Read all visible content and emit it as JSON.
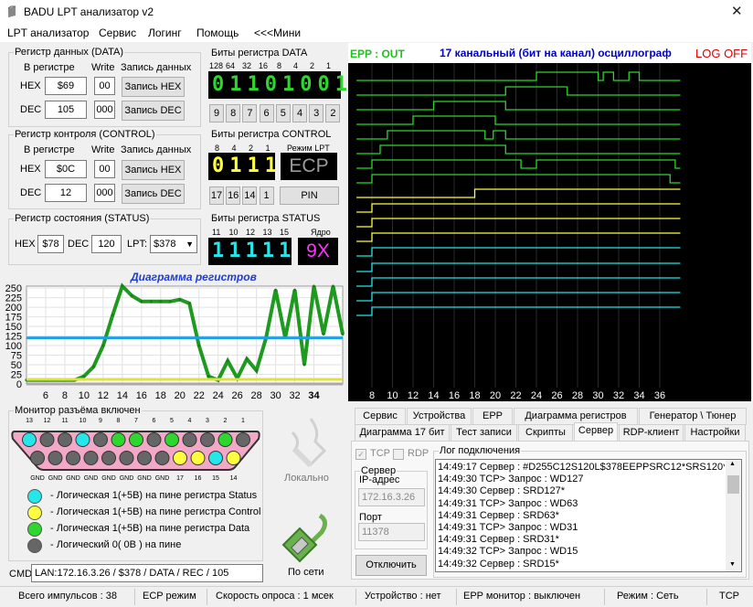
{
  "window": {
    "title": "BADU LPT анализатор v2",
    "close": "✕"
  },
  "menu": [
    "LPT анализатор",
    "Сервис",
    "Логинг",
    "Помощь",
    "<<<Мини"
  ],
  "data_reg": {
    "legend": "Регистр данных (DATA)",
    "in_reg": "В регистре",
    "write": "Write",
    "write_data": "Запись данных",
    "hex_label": "HEX",
    "hex": "$69",
    "hex_w": "00",
    "hex_btn": "Запись HEX",
    "dec_label": "DEC",
    "dec": "105",
    "dec_w": "000",
    "dec_btn": "Запись DEC"
  },
  "ctrl_reg": {
    "legend": "Регистр контроля (CONTROL)",
    "in_reg": "В регистре",
    "write": "Write",
    "write_data": "Запись данных",
    "hex_label": "HEX",
    "hex": "$0C",
    "hex_w": "00",
    "hex_btn": "Запись HEX",
    "dec_label": "DEC",
    "dec": "12",
    "dec_w": "000",
    "dec_btn": "Запись DEC"
  },
  "status_reg": {
    "legend": "Регистр состояния (STATUS)",
    "hex_label": "HEX",
    "hex": "$78",
    "dec_label": "DEC",
    "dec": "120",
    "lpt_label": "LPT:",
    "lpt": "$378"
  },
  "data_bits": {
    "title": "Биты регистра DATA",
    "weights": [
      "128",
      "64",
      "32",
      "16",
      "8",
      "4",
      "2",
      "1"
    ],
    "value": "01101001",
    "buttons": [
      "9",
      "8",
      "7",
      "6",
      "5",
      "4",
      "3",
      "2"
    ]
  },
  "ctrl_bits": {
    "title": "Биты регистра CONTROL",
    "weights": [
      "8",
      "4",
      "2",
      "1"
    ],
    "mode_label": "Режим LPT",
    "value": "0111",
    "mode": "ECP",
    "buttons": [
      "17",
      "16",
      "14",
      "1"
    ],
    "pin_btn": "PIN"
  },
  "status_bits": {
    "title": "Биты регистра STATUS",
    "pins": [
      "11",
      "10",
      "12",
      "13",
      "15"
    ],
    "core_label": "Ядро",
    "value": "11111",
    "core": "9X"
  },
  "diagram": {
    "title": "Диаграмма регистров",
    "yticks": [
      "0",
      "25",
      "50",
      "75",
      "100",
      "125",
      "150",
      "175",
      "200",
      "225",
      "250"
    ],
    "xticks": [
      "6",
      "8",
      "10",
      "12",
      "14",
      "16",
      "18",
      "20",
      "22",
      "24",
      "26",
      "28",
      "30",
      "32",
      "34"
    ]
  },
  "monitor": {
    "title": "Монитор разъёма включен",
    "top_pins": [
      "13",
      "12",
      "11",
      "10",
      "9",
      "8",
      "7",
      "6",
      "5",
      "4",
      "3",
      "2",
      "1"
    ],
    "top_colors": [
      "#27e6ea",
      "#666",
      "#666",
      "#27e6ea",
      "#666",
      "#2ed62e",
      "#2ed62e",
      "#666",
      "#2ed62e",
      "#666",
      "#666",
      "#2ed62e",
      "#666"
    ],
    "bottom_colors": [
      "#666",
      "#666",
      "#666",
      "#666",
      "#666",
      "#666",
      "#666",
      "#666",
      "#ffff40",
      "#ffff40",
      "#27e6ea",
      "#ffff40"
    ],
    "bottom_labels": [
      "GND",
      "GND",
      "GND",
      "GND",
      "GND",
      "GND",
      "GND",
      "GND",
      "17",
      "16",
      "15",
      "14"
    ]
  },
  "legend": [
    {
      "color": "#27e6ea",
      "text": "- Логическая 1(+5В) на пине регистра Status"
    },
    {
      "color": "#ffff40",
      "text": "- Логическая 1(+5В) на пине регистра Control"
    },
    {
      "color": "#2ed62e",
      "text": "- Логическая 1(+5В) на пине регистра Data"
    },
    {
      "color": "#666",
      "text": "- Логический 0( 0В ) на пине"
    }
  ],
  "local_label": "Локально",
  "net_label": "По сети",
  "cmd": {
    "label": "CMD",
    "value": "LAN:172.16.3.26 / $378 / DATA / REC / 105"
  },
  "scope": {
    "mode": "EPP : OUT",
    "title": "17 канальный (бит на канал) осциллограф",
    "log": "LOG OFF",
    "xticks": [
      "8",
      "10",
      "12",
      "14",
      "16",
      "18",
      "20",
      "22",
      "24",
      "26",
      "28",
      "30",
      "32",
      "34",
      "36"
    ]
  },
  "tabs_row1": [
    "Сервис",
    "Устройства",
    "EPP",
    "Диаграмма регистров",
    "Генератор \\ Тюнер"
  ],
  "tabs_row2": [
    "Диаграмма 17 бит",
    "Тест записи",
    "Скрипты",
    "Сервер",
    "RDP-клиент",
    "Настройки"
  ],
  "server": {
    "tcp": "TCP",
    "rdp": "RDP",
    "group": "Сервер",
    "ip_label": "IP-адрес",
    "ip": "172.16.3.26",
    "port_label": "Порт",
    "port": "11378",
    "disconnect": "Отключить",
    "log_title": "Лог подключения",
    "log": [
      "14:49:17 Сервер : #D255C12S120L$378EEPPSRC12*SRS120*",
      "14:49:30 TCP> Запрос : WD127",
      "14:49:30 Сервер : SRD127*",
      "14:49:31 TCP> Запрос : WD63",
      "14:49:31 Сервер : SRD63*",
      "14:49:31 TCP> Запрос : WD31",
      "14:49:31 Сервер : SRD31*",
      "14:49:32 TCP> Запрос : WD15",
      "14:49:32 Сервер : SRD15*"
    ]
  },
  "status": [
    "Всего импульсов : 38",
    "ECP режим",
    "Скорость опроса : 1 мсек",
    "Устройство : нет",
    "EPP монитор : выключен",
    "Режим : Сеть",
    "TCP"
  ],
  "colors": {
    "data": "#2ed62e",
    "ctrl": "#ffff40",
    "status": "#27e6ea",
    "core": "#ff33ff",
    "scope_title": "#0000c8",
    "diagram_title": "#1e3ad6",
    "log_off": "#e00000"
  },
  "chart_data": [
    {
      "type": "line",
      "series": [
        {
          "values": [
            [
              4,
              10
            ],
            [
              9,
              10
            ],
            [
              10,
              20
            ],
            [
              11,
              45
            ],
            [
              12,
              100
            ],
            [
              13,
              180
            ],
            [
              14,
              255
            ],
            [
              15,
              230
            ],
            [
              16,
              215
            ],
            [
              17,
              215
            ],
            [
              18,
              215
            ],
            [
              19,
              215
            ],
            [
              20,
              220
            ],
            [
              21,
              210
            ],
            [
              22,
              100
            ],
            [
              23,
              20
            ],
            [
              24,
              10
            ],
            [
              25,
              60
            ],
            [
              26,
              15
            ],
            [
              27,
              65
            ],
            [
              28,
              35
            ],
            [
              29,
              120
            ],
            [
              30,
              245
            ],
            [
              31,
              120
            ],
            [
              32,
              245
            ],
            [
              33,
              50
            ],
            [
              34,
              255
            ],
            [
              35,
              130
            ],
            [
              36,
              255
            ],
            [
              37,
              130
            ]
          ]
        },
        {
          "values": [
            [
              4,
              0
            ],
            [
              37,
              0
            ]
          ]
        },
        {
          "values": [
            [
              4,
              12
            ],
            [
              37,
              12
            ]
          ]
        },
        {
          "values": [
            [
              4,
              120
            ],
            [
              37,
              120
            ]
          ]
        }
      ],
      "xlim": [
        4,
        37
      ],
      "ylim": [
        0,
        255
      ]
    },
    {
      "type": "line",
      "x_ticks": [
        8,
        10,
        12,
        14,
        16,
        18,
        20,
        22,
        24,
        26,
        28,
        30,
        32,
        34,
        36
      ],
      "channels": 17
    }
  ]
}
